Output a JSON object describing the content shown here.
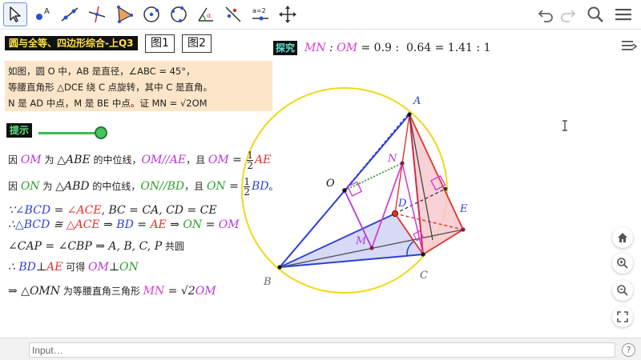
{
  "toolbar": {
    "tools": [
      "move-tool",
      "point-tool",
      "line-tool",
      "perpendicular-tool",
      "polygon-tool",
      "circle-center-tool",
      "circle-three-points-tool",
      "angle-tool",
      "reflect-tool",
      "slider-tool",
      "move-view-tool"
    ],
    "slider_tool_label": "a=2",
    "point_tool_label": "A"
  },
  "title": "圆与全等、四边形综合-上Q3",
  "fig_buttons": [
    "图1",
    "图2"
  ],
  "explore": {
    "label": "探究",
    "ratio_left": "MN",
    "ratio_colon": " : ",
    "ratio_right": "OM",
    "ratio_eq1": " = 0.9 :  0.64 = 1.41 : 1"
  },
  "problem": {
    "line1": "如图，圆 O 中，AB 是直径，∠ABC = 45°，",
    "line2": "等腰直角形 △DCE 绕 C 点旋转，其中 C 是直角。",
    "line3": "N 是 AD 中点，M 是 BE 中点。证 MN = √2OM"
  },
  "hint": {
    "label": "提示",
    "value": 1
  },
  "proof": {
    "l1_a": "因 ",
    "l1_b": "OM",
    "l1_c": " 为 ",
    "l1_d": "△ABE",
    "l1_e": " 的中位线，",
    "l1_f": "OM//AE",
    "l1_g": "，且 ",
    "l1_h": "OM",
    "l1_i": " = ",
    "l1_j": "1",
    "l1_k": "2",
    "l1_l": "AE",
    "l2_a": "因 ",
    "l2_b": "ON",
    "l2_c": " 为 ",
    "l2_d": "△ABD",
    "l2_e": " 的中位线，",
    "l2_f": "ON//BD",
    "l2_g": "，且 ",
    "l2_h": "ON",
    "l2_i": " = ",
    "l2_j": "1",
    "l2_k": "2",
    "l2_l": "BD",
    "l2_m": "。",
    "l3_a": "∵",
    "l3_b": "∠BCD",
    "l3_c": " = ",
    "l3_d": "∠ACE",
    "l3_e": ", BC = CA, CD = CE",
    "l4_a": "∴",
    "l4_b": "△BCD",
    "l4_c": " ≅ ",
    "l4_d": "△ACE",
    "l4_e": " ⇒ ",
    "l4_f": "BD",
    "l4_g": " = ",
    "l4_h": "AE",
    "l4_i": " ⇒ ",
    "l4_j": "ON",
    "l4_k": " = ",
    "l4_l": "OM",
    "l5_a": "∠CAP = ∠CBP ⇒ A, B, C, P",
    "l5_b": "  共圆",
    "l6_a": "∴ ",
    "l6_b": "BD",
    "l6_c": "⊥",
    "l6_d": "AE",
    "l6_e": "  可得 ",
    "l6_f": "OM",
    "l6_g": "⊥",
    "l6_h": "ON",
    "l7_a": "⇒ △OMN",
    "l7_b": "  为等腰直角三角形 ",
    "l7_c": "MN",
    "l7_d": " = √2",
    "l7_e": "OM"
  },
  "points": {
    "A": "A",
    "B": "B",
    "C": "C",
    "D": "D",
    "E": "E",
    "O": "O",
    "N": "N",
    "M": "M"
  },
  "input": {
    "placeholder": "Input…"
  },
  "colors": {
    "circle": "#f2d71c",
    "blue": "#2c3fd8",
    "pink": "#d23fd1",
    "red": "#e4312b",
    "green": "#2f9f2f",
    "fill_pink": "#f7c9cf"
  }
}
